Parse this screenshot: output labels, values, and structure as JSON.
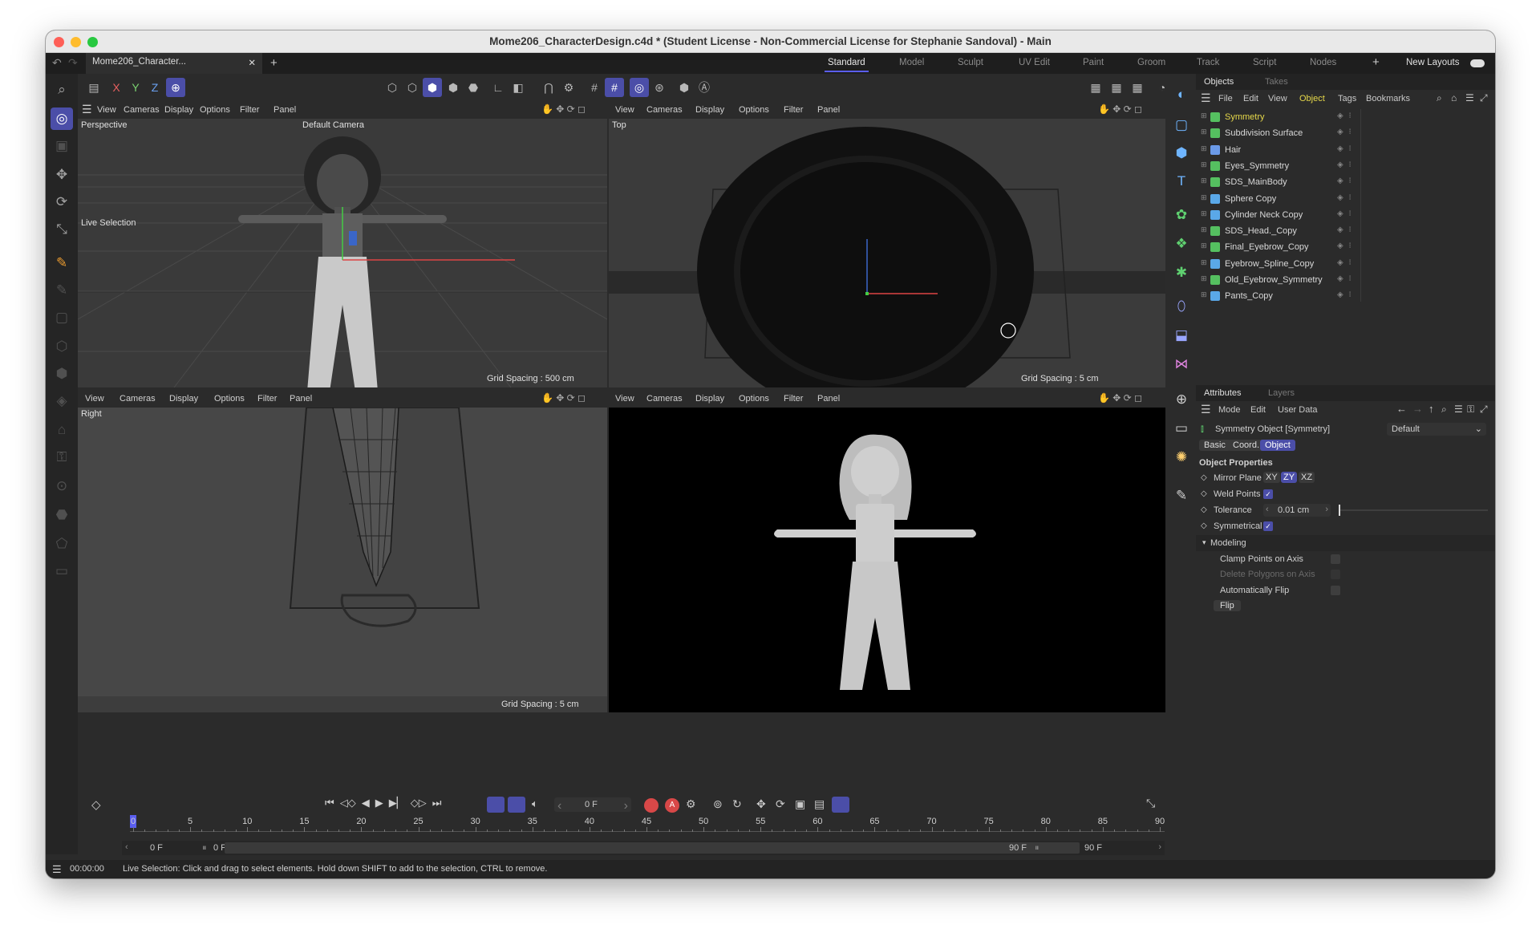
{
  "window": {
    "title": "Mome206_CharacterDesign.c4d * (Student License - Non-Commercial License for Stephanie Sandoval) - Main"
  },
  "tabs": {
    "doc": "Mome206_Character...",
    "layouts": [
      "Standard",
      "Model",
      "Sculpt",
      "UV Edit",
      "Paint",
      "Groom",
      "Track",
      "Script",
      "Nodes"
    ],
    "new_layouts": "New Layouts"
  },
  "axis_buttons": [
    "X",
    "Y",
    "Z"
  ],
  "viewport_menu": [
    "View",
    "Cameras",
    "Display",
    "Options",
    "Filter",
    "Panel"
  ],
  "viewports": {
    "perspective": {
      "label": "Perspective",
      "camera": "Default Camera",
      "tool": "Live Selection",
      "grid": "Grid Spacing : 500 cm"
    },
    "top": {
      "label": "Top",
      "grid": "Grid Spacing : 5 cm"
    },
    "right": {
      "label": "Right",
      "grid": "Grid Spacing : 5 cm"
    }
  },
  "objects_panel": {
    "tabs": [
      "Objects",
      "Takes"
    ],
    "menu": [
      "File",
      "Edit",
      "View",
      "Object",
      "Tags",
      "Bookmarks"
    ],
    "items": [
      {
        "name": "Symmetry",
        "color": "#e6d84a",
        "icon": "#55c060"
      },
      {
        "name": "Subdivision Surface",
        "color": "#d8d8d8",
        "icon": "#55c060"
      },
      {
        "name": "Hair",
        "color": "#d8d8d8",
        "icon": "#6b9ae8"
      },
      {
        "name": "Eyes_Symmetry",
        "color": "#d8d8d8",
        "icon": "#55c060"
      },
      {
        "name": "SDS_MainBody",
        "color": "#d8d8d8",
        "icon": "#55c060"
      },
      {
        "name": "Sphere Copy",
        "color": "#d8d8d8",
        "icon": "#5aa8e8"
      },
      {
        "name": "Cylinder Neck Copy",
        "color": "#d8d8d8",
        "icon": "#5aa8e8"
      },
      {
        "name": "SDS_Head._Copy",
        "color": "#d8d8d8",
        "icon": "#55c060"
      },
      {
        "name": "Final_Eyebrow_Copy",
        "color": "#d8d8d8",
        "icon": "#55c060"
      },
      {
        "name": "Eyebrow_Spline_Copy",
        "color": "#d8d8d8",
        "icon": "#5aa8e8"
      },
      {
        "name": "Old_Eyebrow_Symmetry",
        "color": "#d8d8d8",
        "icon": "#55c060"
      },
      {
        "name": "Pants_Copy",
        "color": "#d8d8d8",
        "icon": "#5aa8e8"
      }
    ]
  },
  "attributes_panel": {
    "tabs": [
      "Attributes",
      "Layers"
    ],
    "menu": [
      "Mode",
      "Edit",
      "User Data"
    ],
    "object_title": "Symmetry Object [Symmetry]",
    "preset": "Default",
    "subtabs": [
      "Basic",
      "Coord.",
      "Object"
    ],
    "section": "Object Properties",
    "mirror_plane_label": "Mirror Plane",
    "planes": [
      "XY",
      "ZY",
      "XZ"
    ],
    "weld_points": "Weld Points",
    "tolerance_label": "Tolerance",
    "tolerance_value": "0.01 cm",
    "symmetrical": "Symmetrical",
    "modeling": "Modeling",
    "clamp": "Clamp Points on Axis",
    "delete_polys": "Delete Polygons on Axis",
    "auto_flip": "Automatically Flip",
    "flip": "Flip"
  },
  "timeline": {
    "current_frame": "0 F",
    "ticks": [
      "0",
      "5",
      "10",
      "15",
      "20",
      "25",
      "30",
      "35",
      "40",
      "45",
      "50",
      "55",
      "60",
      "65",
      "70",
      "75",
      "80",
      "85",
      "90"
    ],
    "range_start": "0 F",
    "range_start2": "0 F",
    "range_end": "90 F",
    "range_end2": "90 F"
  },
  "status": {
    "time": "00:00:00",
    "message": "Live Selection: Click and drag to select elements. Hold down SHIFT to add to the selection, CTRL to remove."
  }
}
